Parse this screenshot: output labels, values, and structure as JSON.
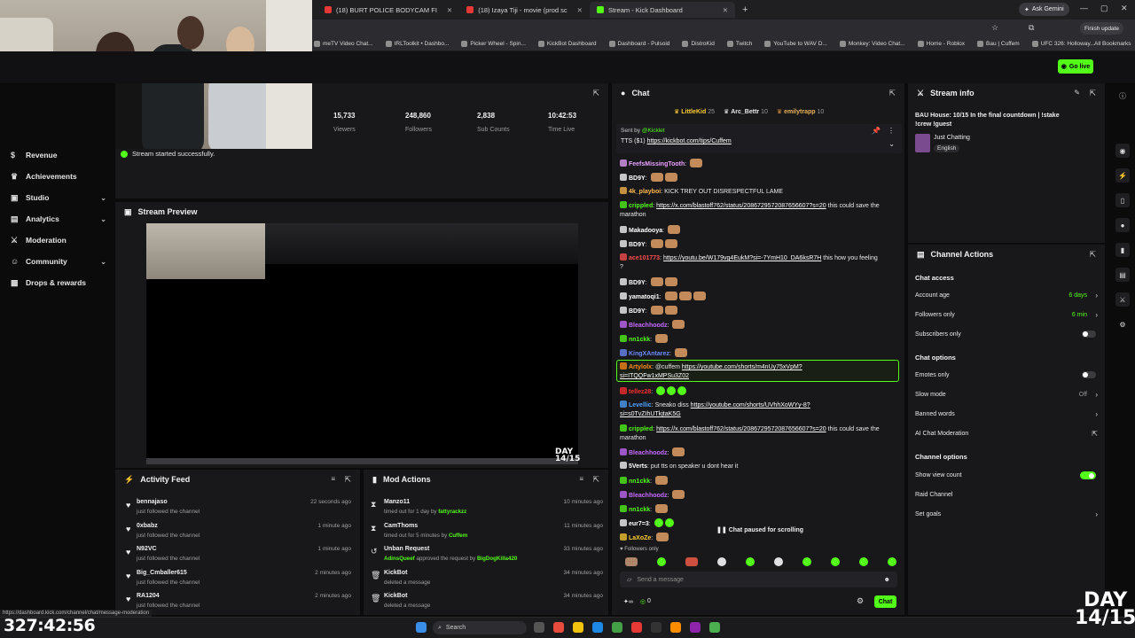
{
  "browser": {
    "tabs": [
      {
        "label": "(18) BURT POLICE BODYCAM FI",
        "active": false
      },
      {
        "label": "(18) Izaya Tiji - movie (prod sc",
        "active": false
      },
      {
        "label": "Stream - Kick Dashboard",
        "active": true
      }
    ],
    "ask_gemini": "Ask Gemini",
    "finish_update": "Finish update",
    "bookmarks": [
      "meTV Video Chat...",
      "IRLToolkit • Dashbo...",
      "Picker Wheel - Spin...",
      "KickBot Dashboard",
      "Dashboard - Pulsoid",
      "DistroKid",
      "Twitch",
      "YouTube to WAV D...",
      "Monkey: Video Chat...",
      "Home - Roblox",
      "Bau | Cuffem",
      "UFC 326: Holloway..."
    ],
    "all_bookmarks": "All Bookmarks",
    "status_url": "https://dashboard.kick.com/channel/chat/message-moderation"
  },
  "header": {
    "go_live": "Go live"
  },
  "sidebar": {
    "items": [
      {
        "label": "Revenue",
        "icon": "dollar-icon",
        "chevron": false
      },
      {
        "label": "Achievements",
        "icon": "trophy-icon",
        "chevron": false
      },
      {
        "label": "Studio",
        "icon": "camera-icon",
        "chevron": true
      },
      {
        "label": "Analytics",
        "icon": "chart-icon",
        "chevron": true
      },
      {
        "label": "Moderation",
        "icon": "sword-icon",
        "chevron": false
      },
      {
        "label": "Community",
        "icon": "people-icon",
        "chevron": true
      },
      {
        "label": "Drops & rewards",
        "icon": "gift-icon",
        "chevron": false
      }
    ]
  },
  "stats": [
    {
      "value": "15,733",
      "label": "Viewers"
    },
    {
      "value": "248,860",
      "label": "Followers"
    },
    {
      "value": "2,838",
      "label": "Sub Counts"
    },
    {
      "value": "10:42:53",
      "label": "Time Live"
    }
  ],
  "toast": "Stream started successfully.",
  "preview": {
    "title": "Stream Preview",
    "day_top": "DAY",
    "day_bottom": "14/15"
  },
  "activity": {
    "title": "Activity Feed",
    "rows": [
      {
        "name": "bennajaso",
        "desc": "just followed the channel",
        "time": "22 seconds ago"
      },
      {
        "name": "0xbabz",
        "desc": "just followed the channel",
        "time": "1 minute ago"
      },
      {
        "name": "N92VC",
        "desc": "just followed the channel",
        "time": "1 minute ago"
      },
      {
        "name": "Big_Cmballer615",
        "desc": "just followed the channel",
        "time": "2 minutes ago"
      },
      {
        "name": "RA1204",
        "desc": "just followed the channel",
        "time": "2 minutes ago"
      }
    ]
  },
  "mod_actions": {
    "title": "Mod Actions",
    "rows": [
      {
        "icon": "hourglass-icon",
        "name": "Manzo11",
        "desc": "timed out for 1 day by",
        "by": "fattyrackzz",
        "by2": "",
        "time": "10 minutes ago"
      },
      {
        "icon": "hourglass-icon",
        "name": "CamThoms",
        "desc": "timed out for 5 minutes by",
        "by": "Cuffem",
        "by2": "",
        "time": "11 minutes ago"
      },
      {
        "icon": "undo-icon",
        "name": "Unban Request",
        "desc": "approved the request by",
        "by": "AdinsQueef",
        "by2": "BigDogKilla420",
        "time": "33 minutes ago"
      },
      {
        "icon": "trash-icon",
        "name": "KickBot",
        "desc": "deleted a message",
        "by": "",
        "by2": "",
        "time": "34 minutes ago"
      },
      {
        "icon": "trash-icon",
        "name": "KickBot",
        "desc": "deleted a message",
        "by": "",
        "by2": "",
        "time": "34 minutes ago"
      }
    ]
  },
  "chat": {
    "title": "Chat",
    "top_gifters": [
      {
        "name": "LittleKid",
        "count": "25"
      },
      {
        "name": "Arc_Bettr",
        "count": "10"
      },
      {
        "name": "emilytrapp",
        "count": "10"
      }
    ],
    "pinned_sender": "Sent by",
    "pinned_handle": "@Kicklet",
    "pinned_text": "TTS ($1)",
    "pinned_link": "https://kickbot.com/tips/Cuffem",
    "messages": [
      {
        "user": "FeefsMissingTooth",
        "color": "#e8a0ff",
        "text": "",
        "link": ""
      },
      {
        "user": "BD9Y",
        "color": "#ffffff",
        "text": "",
        "link": ""
      },
      {
        "user": "4k_playboi",
        "color": "#ffb84d",
        "text": "KICK TREY OUT DISRESPECTFUL LAME",
        "link": ""
      },
      {
        "user": "crippled",
        "color": "#53fc18",
        "text": "",
        "link": "https://x.com/blastoff762/status/2086729572087656607?s=20",
        "text2": "this could save the"
      },
      {
        "user": "",
        "color": "#ffffff",
        "text": "marathon",
        "link": ""
      },
      {
        "user": "Makadooya",
        "color": "#ffffff",
        "text": "",
        "link": ""
      },
      {
        "user": "BD9Y",
        "color": "#ffffff",
        "text": "",
        "link": ""
      },
      {
        "user": "ace101773",
        "color": "#ff4d4d",
        "text": "",
        "link": "https://youtu.be/W179vg4EukM?si=-7YmH10_DA6ksR7H",
        "text2": "this how you feeling"
      },
      {
        "user": "",
        "color": "#ffffff",
        "text": "?",
        "link": ""
      },
      {
        "user": "BD9Y",
        "color": "#ffffff",
        "text": "",
        "link": ""
      },
      {
        "user": "yamatoqi1",
        "color": "#ffffff",
        "text": "",
        "link": ""
      },
      {
        "user": "BD9Y",
        "color": "#ffffff",
        "text": "",
        "link": ""
      },
      {
        "user": "Bleachhoodz",
        "color": "#c86bff",
        "text": "",
        "link": ""
      },
      {
        "user": "nn1ckk",
        "color": "#53fc18",
        "text": "",
        "link": ""
      },
      {
        "user": "KingXAntarez",
        "color": "#6b8cff",
        "text": "",
        "link": ""
      },
      {
        "user": "Artylolx",
        "color": "#ff8c1a",
        "text": "@cuffem",
        "link": "https://youtube.com/shorts/m4nUy75xVpM?",
        "text2": ""
      },
      {
        "user": "",
        "color": "#ffffff",
        "text": "",
        "link": "si=ITQQFw1xMPSu3Z02"
      },
      {
        "user": "tellez28",
        "color": "#ff2d2d",
        "text": "",
        "link": ""
      },
      {
        "user": "Levellic",
        "color": "#4da3ff",
        "text": "Sneako diss",
        "link": "https://youtube.com/shorts/UVhhXoWYy-8?",
        "text2": ""
      },
      {
        "user": "",
        "color": "#ffffff",
        "text": "",
        "link": "si=s0TvZIhUTkjtaK5G"
      },
      {
        "user": "crippled",
        "color": "#53fc18",
        "text": "",
        "link": "https://x.com/blastoff762/status/2086729572087656607?s=20",
        "text2": "this could save the"
      },
      {
        "user": "",
        "color": "#ffffff",
        "text": "marathon",
        "link": ""
      },
      {
        "user": "Bleachhoodz",
        "color": "#c86bff",
        "text": "",
        "link": ""
      },
      {
        "user": "5Verts",
        "color": "#ffffff",
        "text": "put tts on speaker u dont hear it",
        "link": ""
      },
      {
        "user": "nn1ckk",
        "color": "#53fc18",
        "text": "",
        "link": ""
      },
      {
        "user": "Bleachhoodz",
        "color": "#c86bff",
        "text": "",
        "link": ""
      },
      {
        "user": "nn1ckk",
        "color": "#53fc18",
        "text": "",
        "link": ""
      },
      {
        "user": "eur7=3",
        "color": "#ffffff",
        "text": "",
        "link": ""
      },
      {
        "user": "LaXoZe",
        "color": "#ffcc33",
        "text": "",
        "link": ""
      }
    ],
    "paused": "Chat paused for scrolling",
    "followers_only": "Followers only",
    "input_placeholder": "Send a message",
    "points": "0",
    "send": "Chat"
  },
  "stream_info": {
    "title": "Stream info",
    "stream_title": "BAU House: 10/15 In the final countdown | !stake !crew !guest",
    "category": "Just Chatting",
    "tag": "English"
  },
  "channel_actions": {
    "title": "Channel Actions",
    "chat_access": "Chat access",
    "account_age": {
      "label": "Account age",
      "value": "6 days"
    },
    "followers_only": {
      "label": "Followers only",
      "value": "6 min"
    },
    "subscribers_only": {
      "label": "Subscribers only",
      "on": false
    },
    "chat_options": "Chat options",
    "emotes_only": {
      "label": "Emotes only",
      "on": false
    },
    "slow_mode": {
      "label": "Slow mode",
      "value": "Off"
    },
    "banned_words": "Banned words",
    "ai_moderation": "AI Chat Moderation",
    "channel_options": "Channel options",
    "show_view_count": {
      "label": "Show view count",
      "on": true
    },
    "raid_channel": "Raid Channel",
    "set_goals": "Set goals"
  },
  "overlay": {
    "clock": "327:42:56",
    "day_top": "DAY",
    "day_bottom": "14/15"
  },
  "taskbar": {
    "search": "Search"
  },
  "colors": {
    "kick_green": "#53fc18",
    "panel": "#18181b",
    "bg": "#0b0b0c"
  }
}
